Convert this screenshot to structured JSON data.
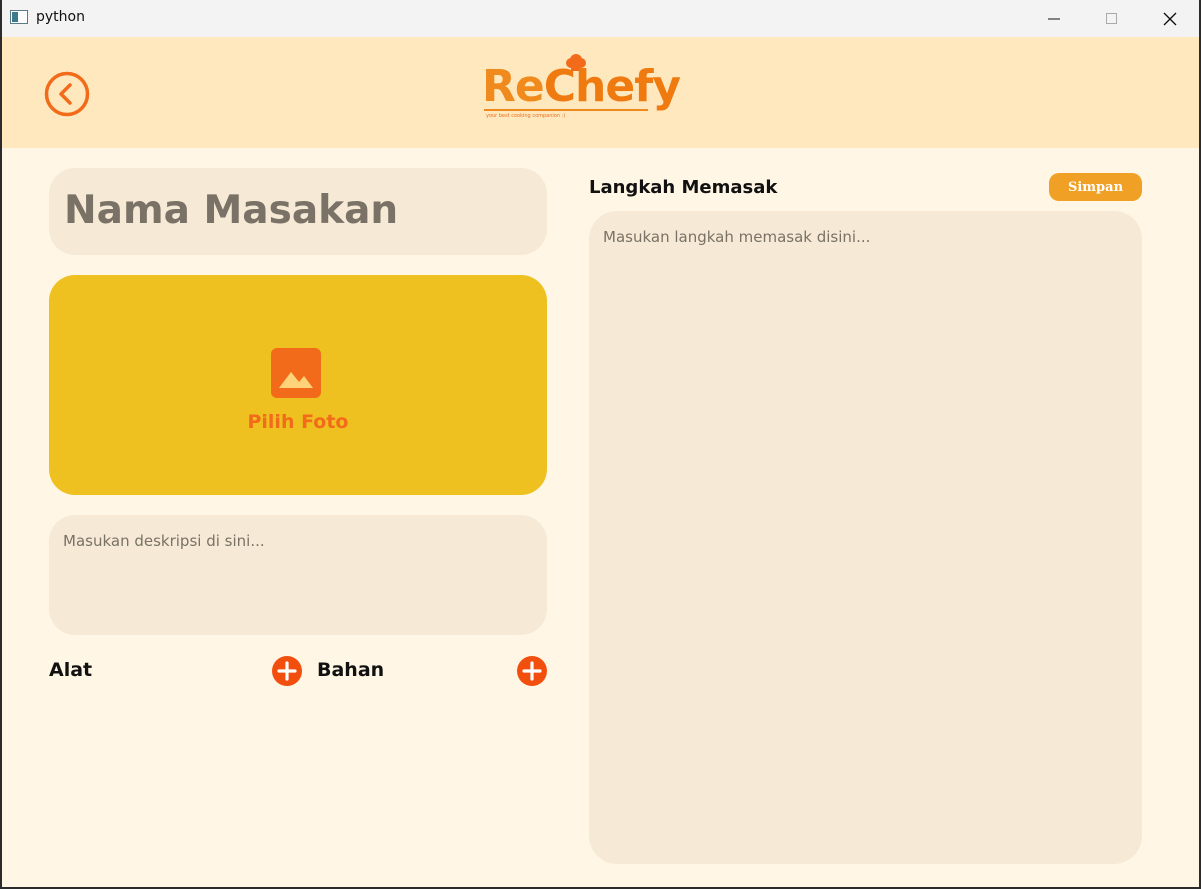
{
  "window": {
    "title": "python"
  },
  "header": {
    "logo_text_a": "Re",
    "logo_text_b": "Chefy",
    "logo_tagline": "your best cooking companion :)",
    "colors": {
      "background": "#ffe8be",
      "accent": "#f26b1a"
    }
  },
  "form": {
    "name_placeholder": "Nama Masakan",
    "photo_label": "Pilih Foto",
    "description_placeholder": "Masukan deskripsi di sini...",
    "tools_label": "Alat",
    "ingredients_label": "Bahan"
  },
  "steps": {
    "title": "Langkah Memasak",
    "save_label": "Simpan",
    "placeholder": "Masukan langkah memasak disini..."
  },
  "icons": {
    "back": "chevron-left-circle-icon",
    "photo": "image-icon",
    "add": "plus-circle-icon"
  }
}
